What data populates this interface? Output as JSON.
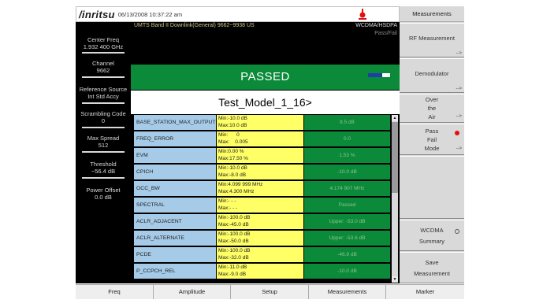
{
  "header": {
    "logo": "/inritsu",
    "datetime": "06/13/2008 10:37:22 am"
  },
  "left_panel": [
    {
      "label": "Center Freq",
      "value": "1.932 400 GHz"
    },
    {
      "label": "Channel",
      "value": "9662"
    },
    {
      "label": "Reference Source",
      "value": "Int Std Accy"
    },
    {
      "label": "Scrambling Code",
      "value": "0"
    },
    {
      "label": "Max Spread",
      "value": "512"
    },
    {
      "label": "Threshold",
      "value": "−56.4 dB"
    },
    {
      "label": "Power Offset",
      "value": "0.0 dB"
    }
  ],
  "main": {
    "band": "UMTS Band II Downlink(General) 9662~9938 US",
    "standard": "WCDMA/HSDPA",
    "mode_label": "Pass/Fail",
    "status": "PASSED",
    "model": "Test_Model_1_16>"
  },
  "table": [
    {
      "name": "BASE_STATION_MAX_OUTPUT",
      "limits": "Min:-10.0 dB\nMax:10.0 dB",
      "result": "8.5 dB"
    },
    {
      "name": "FREQ_ERROR",
      "limits": "Min:      0\nMax:    0.005",
      "result": "0.0"
    },
    {
      "name": "EVM",
      "limits": "Min:0.00 %\nMax:17.50 %",
      "result": "1.53 %"
    },
    {
      "name": "CPICH",
      "limits": "Min:-10.0 dB\nMax:-8.0 dB",
      "result": "-10.0 dB"
    },
    {
      "name": "OCC_BW",
      "limits": "Min:4.099 999 MHz\nMax:4.300 MHz",
      "result": "4.174 907 MHz"
    },
    {
      "name": "SPECTRAL",
      "limits": "Min:- - -\nMax:- - -",
      "result": "Passed"
    },
    {
      "name": "ACLR_ADJACENT",
      "limits": "Min:-100.0 dB\nMax:-45.0 dB",
      "result": "Upper: -53.0 dB"
    },
    {
      "name": "ACLR_ALTERNATE",
      "limits": "Min:-100.0 dB\nMax:-50.0 dB",
      "result": "Upper: -53.6 dB"
    },
    {
      "name": "PCDE",
      "limits": "Min:-100.0 dB\nMax:-32.0 dB",
      "result": "-46.9 dB"
    },
    {
      "name": "P_CCPCH_REL",
      "limits": "Min:-11.0 dB\nMax:-9.0 dB",
      "result": "-10.0 dB"
    }
  ],
  "softkeys": {
    "title": "Measurements",
    "rf_measurement": "RF Measurement",
    "demodulator": "Demodulator",
    "ota_1": "Over",
    "ota_2": "the",
    "ota_3": "Air",
    "pf_1": "Pass",
    "pf_2": "Fail",
    "pf_3": "Mode",
    "wcdma": "WCDMA",
    "summary": "Summary",
    "save": "Save",
    "measurement": "Measurement",
    "arrow": "-->"
  },
  "bottom_menu": [
    "Freq",
    "Amplitude",
    "Setup",
    "Measurements",
    "Marker"
  ],
  "colors": {
    "pass_green": "#0b8a3a",
    "name_blue": "#a6cbe8",
    "limit_yellow": "#ffff66",
    "alert_red": "#e01010"
  }
}
